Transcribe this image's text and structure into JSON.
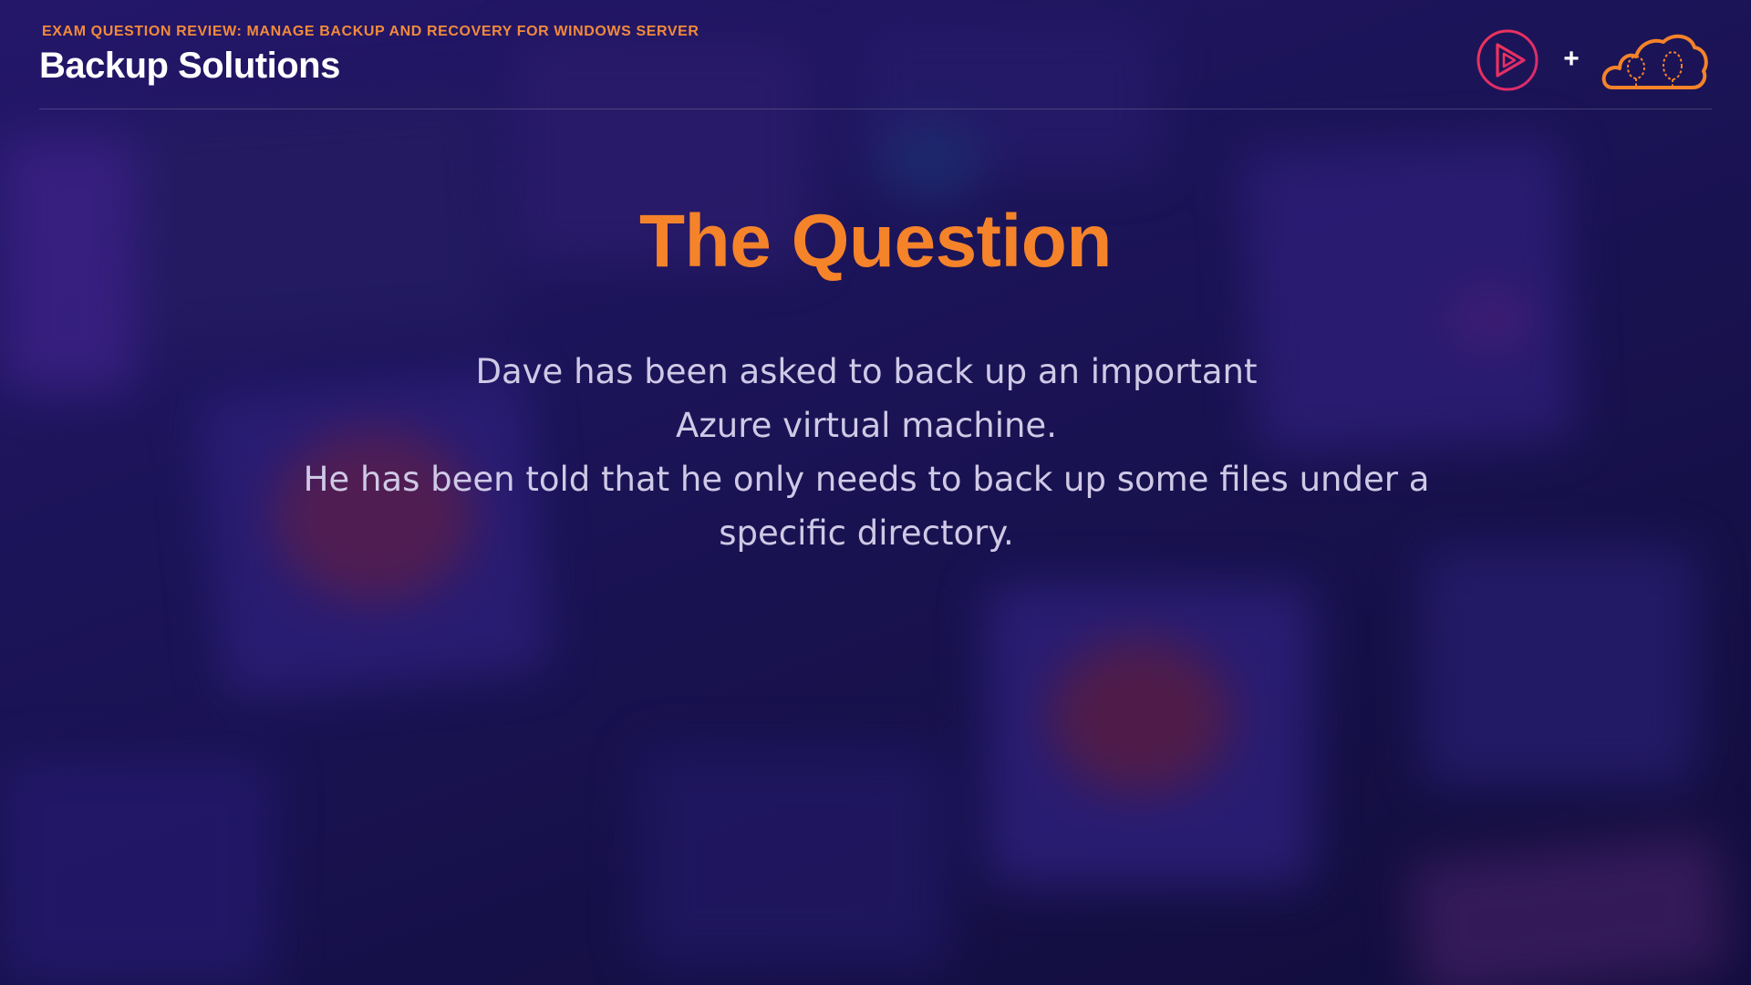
{
  "header": {
    "eyebrow": "EXAM QUESTION REVIEW: MANAGE BACKUP AND RECOVERY FOR WINDOWS SERVER",
    "title": "Backup Solutions",
    "logos": {
      "left_icon": "pluralsight-play-icon",
      "separator": "+",
      "right_icon": "cloud-gurus-icon"
    }
  },
  "main": {
    "title": "The Question",
    "question_lines": [
      "Dave has been asked to back up an important",
      "Azure virtual machine.",
      "He has been told that he only needs to back up some files under a",
      "specific directory."
    ]
  },
  "colors": {
    "accent_orange": "#f5832a",
    "eyebrow_orange": "#f28a3c",
    "pluralsight_red": "#e8365d",
    "background": "#1c1459",
    "body_text": "#cfc9e6"
  }
}
